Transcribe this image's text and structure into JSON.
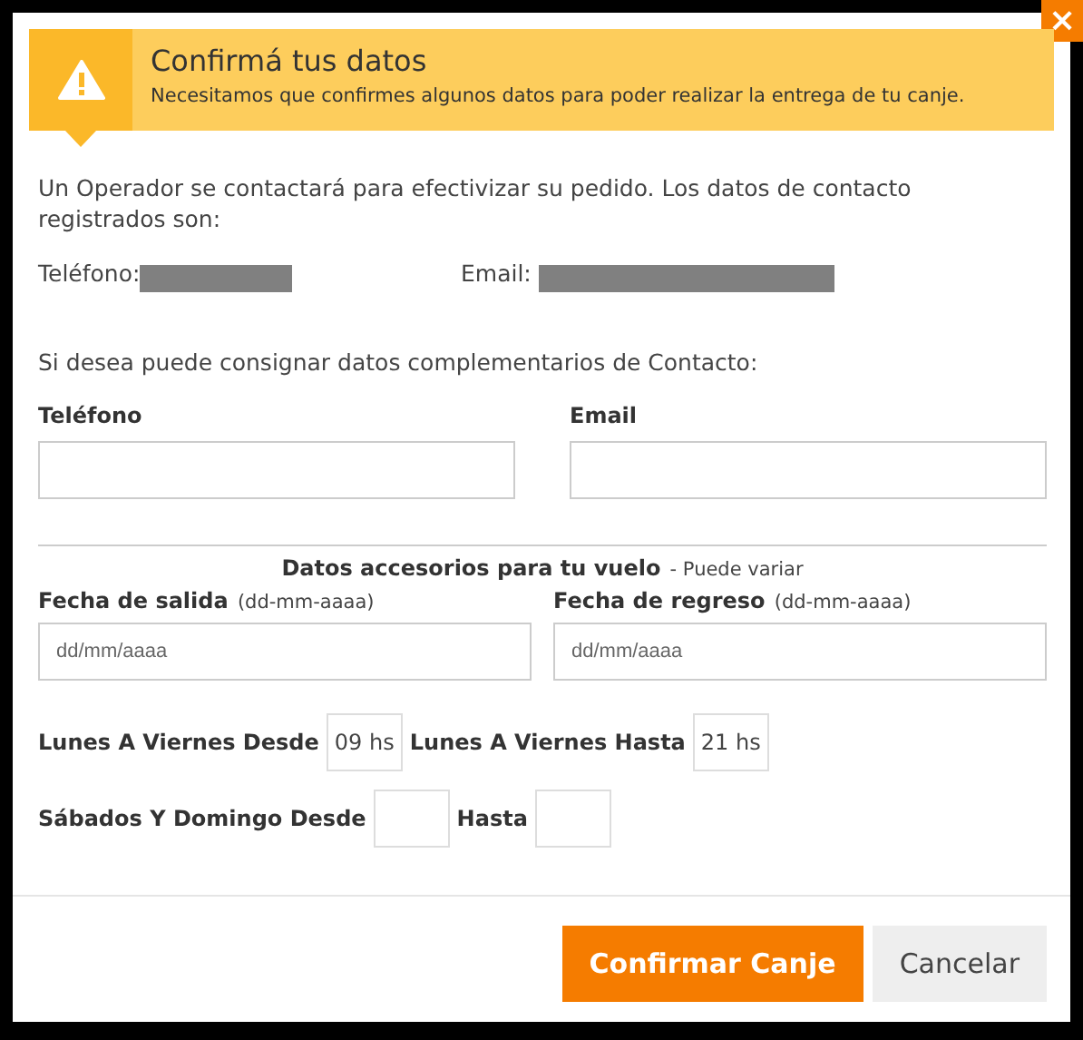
{
  "close_button": {
    "label": "×"
  },
  "banner": {
    "title": "Confirmá tus datos",
    "subtitle": "Necesitamos que confirmes algunos datos para poder realizar la entrega de tu canje."
  },
  "intro": "Un Operador se contactará para efectivizar su pedido. Los datos de contacto registrados son:",
  "registered": [
    {
      "label": "Teléfono:"
    },
    {
      "label": "Email:"
    }
  ],
  "complement_note": "Si desea puede consignar datos complementarios de Contacto:",
  "contact_fields": [
    {
      "label": "Teléfono"
    },
    {
      "label": "Email"
    }
  ],
  "flight": {
    "title": "Datos accesorios para tu vuelo",
    "note": "- Puede variar",
    "fields": [
      {
        "label": "Fecha de salida",
        "hint": "(dd-mm-aaaa)",
        "placeholder": "dd/mm/aaaa"
      },
      {
        "label": "Fecha de regreso",
        "hint": "(dd-mm-aaaa)",
        "placeholder": "dd/mm/aaaa"
      }
    ]
  },
  "schedule_rows": [
    [
      {
        "label": "Lunes A Viernes Desde",
        "value": "09 hs"
      },
      {
        "label": "Lunes A Viernes Hasta",
        "value": "21 hs"
      }
    ],
    [
      {
        "label": "Sábados Y Domingo Desde"
      },
      {
        "label": "Hasta"
      }
    ]
  ],
  "buttons": [
    {
      "label": "Confirmar Canje",
      "kind": "primary"
    },
    {
      "label": "Cancelar",
      "kind": "secondary"
    }
  ]
}
